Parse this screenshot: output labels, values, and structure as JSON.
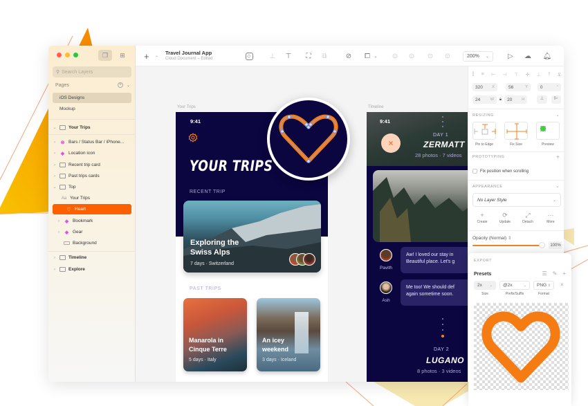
{
  "window": {
    "document_title": "Travel Journal App",
    "document_subtitle": "Cloud Document – Edited"
  },
  "sidebar": {
    "search_placeholder": "Search Layers",
    "pages_label": "Pages",
    "pages": [
      {
        "label": "iOS Designs",
        "active": true
      },
      {
        "label": "Mockup",
        "active": false
      }
    ],
    "layers": [
      {
        "label": "Your Trips",
        "type": "artboard",
        "expanded": true,
        "depth": 0
      },
      {
        "label": "Bars / Status Bar / iPhone...",
        "type": "symbol-group",
        "depth": 1
      },
      {
        "label": "Location icon",
        "type": "symbol",
        "depth": 1
      },
      {
        "label": "Recent trip card",
        "type": "group",
        "depth": 1
      },
      {
        "label": "Past trips cards",
        "type": "group",
        "depth": 1
      },
      {
        "label": "Top",
        "type": "group",
        "expanded": true,
        "depth": 1
      },
      {
        "label": "Your Trips",
        "type": "text",
        "depth": 2
      },
      {
        "label": "Heart",
        "type": "shape",
        "depth": 2,
        "selected": true
      },
      {
        "label": "Bookmark",
        "type": "symbol",
        "depth": 2
      },
      {
        "label": "Gear",
        "type": "symbol",
        "depth": 2
      },
      {
        "label": "Background",
        "type": "rectangle",
        "depth": 2
      },
      {
        "label": "Timeline",
        "type": "artboard",
        "depth": 0
      },
      {
        "label": "Explore",
        "type": "artboard",
        "depth": 0
      }
    ]
  },
  "toolbar": {
    "insert_icon": "plus-icon",
    "zoom_level": "200%"
  },
  "canvas": {
    "trips_artboard": {
      "label": "Your Trips",
      "time": "9:41",
      "title": "YOUR TRIPS",
      "recent_label": "RECENT TRIP",
      "recent_card": {
        "title_line1": "Exploring the",
        "title_line2": "Swiss Alps",
        "subtitle": "7 days · Switzerland"
      },
      "past_label": "PAST TRIPS",
      "past_cards": [
        {
          "title_line1": "Manarola in",
          "title_line2": "Cinque Terre",
          "subtitle": "5 days · Italy"
        },
        {
          "title_line1": "An icey",
          "title_line2": "weekend",
          "subtitle": "3 days · Iceland"
        }
      ]
    },
    "timeline_artboard": {
      "label": "Timeline",
      "time": "9:41",
      "day1": {
        "day": "DAY 1",
        "city": "ZERMATT",
        "meta": "28 photos · 7 videos"
      },
      "messages": [
        {
          "name": "Pavith",
          "line1": "Aw! I loved our stay in",
          "line2": "Beautiful place. Let's g"
        },
        {
          "name": "Ash",
          "line1": "Me too! We should def",
          "line2": "again sometime soon."
        }
      ],
      "day2": {
        "day": "DAY 2",
        "city": "LUGANO",
        "meta": "8 photos · 3 videos"
      }
    }
  },
  "inspector": {
    "x": "320",
    "x_unit": "X",
    "y": "56",
    "y_unit": "Y",
    "rotation": "0",
    "rotation_unit": "°",
    "width": "24",
    "width_unit": "W",
    "height": "20",
    "height_unit": "H",
    "resizing_title": "RESIZING",
    "resize_options": [
      "Pin to Edge",
      "Fix Size",
      "Preview"
    ],
    "prototyping_title": "PROTOTYPING",
    "fix_position_label": "Fix position when scrolling",
    "appearance_title": "APPEARANCE",
    "layer_style": "No Layer Style",
    "style_actions": [
      {
        "label": "Create",
        "icon": "+"
      },
      {
        "label": "Update",
        "icon": "⟳"
      },
      {
        "label": "Detach",
        "icon": "⤢"
      },
      {
        "label": "More",
        "icon": "···"
      }
    ],
    "opacity_label": "Opacity (Normal)",
    "opacity_value": "100%",
    "opacity_fraction": 1.0
  },
  "export": {
    "title": "EXPORT",
    "presets_label": "Presets",
    "size": "2x",
    "suffix": "@2x",
    "format": "PNG",
    "size_label": "Size",
    "suffix_label": "Prefix/Suffix",
    "format_label": "Format"
  },
  "colors": {
    "accent": "#fb6100",
    "heart": "#f57b13",
    "artboard_bg": "#0b0540",
    "symbol": "#d44bd8"
  }
}
